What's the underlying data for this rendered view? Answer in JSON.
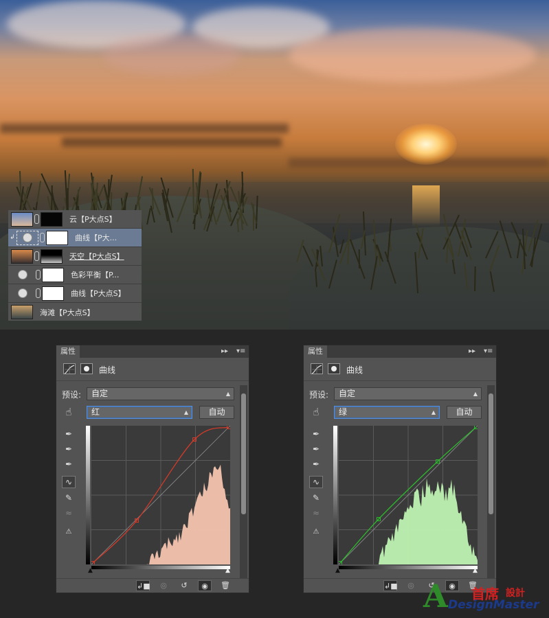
{
  "layers": [
    {
      "name": "云【P大点S】",
      "thumb": "sky-photo",
      "has_chain": true,
      "mask": "dark",
      "selected": false,
      "clipped": false
    },
    {
      "name": "曲线【P大...",
      "thumb": "curves-adjustment",
      "has_chain": true,
      "mask": "white",
      "selected": true,
      "clipped": true
    },
    {
      "name": "天空【P大点S】",
      "thumb": "sunset-photo",
      "has_chain": true,
      "mask": "gradient",
      "selected": false,
      "clipped": false
    },
    {
      "name": "色彩平衡【P...",
      "thumb": "balance-adjustment",
      "has_chain": true,
      "mask": "white",
      "selected": false,
      "clipped": false
    },
    {
      "name": "曲线【P大点S】",
      "thumb": "curves-adjustment",
      "has_chain": true,
      "mask": "white",
      "selected": false,
      "clipped": false
    },
    {
      "name": "海滩【P大点S】",
      "thumb": "beach-photo",
      "has_chain": false,
      "mask": null,
      "selected": false,
      "clipped": false
    }
  ],
  "panels": [
    {
      "tab": "属性",
      "title": "曲线",
      "preset_label": "预设:",
      "preset_value": "自定",
      "channel_value": "红",
      "auto_label": "自动",
      "accent": "#d23a2a",
      "fill": "#f4c3ae",
      "points": [
        [
          0,
          0
        ],
        [
          64,
          62
        ],
        [
          148,
          180
        ],
        [
          198,
          198
        ]
      ],
      "histogram_seed": 1
    },
    {
      "tab": "属性",
      "title": "曲线",
      "preset_label": "预设:",
      "preset_value": "自定",
      "channel_value": "绿",
      "auto_label": "自动",
      "accent": "#2eb82e",
      "fill": "#bff2b2",
      "points": [
        [
          0,
          0
        ],
        [
          56,
          64
        ],
        [
          142,
          148
        ],
        [
          198,
          198
        ]
      ],
      "histogram_seed": 2
    }
  ],
  "logo": {
    "cn": "首席",
    "cn2": "設計",
    "en": "DesignMaster",
    "mark": "A"
  }
}
